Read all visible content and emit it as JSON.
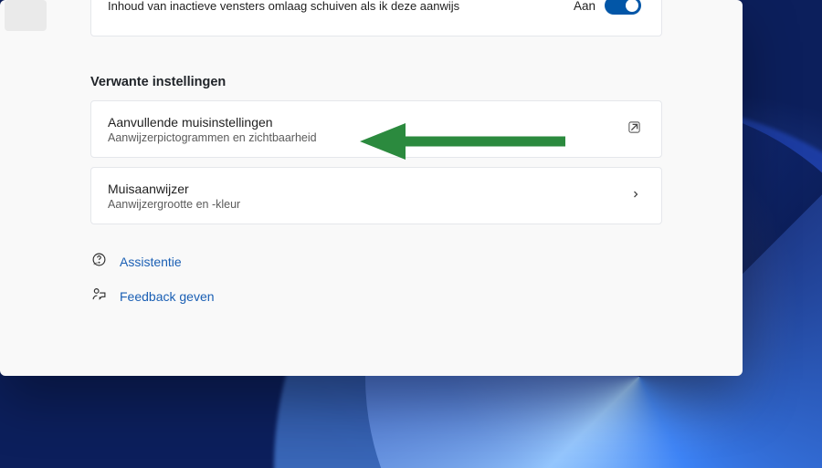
{
  "topcard": {
    "label": "Inhoud van inactieve vensters omlaag schuiven als ik deze aanwijs",
    "state": "Aan"
  },
  "section": {
    "heading": "Verwante instellingen",
    "items": [
      {
        "title": "Aanvullende muisinstellingen",
        "subtitle": "Aanwijzerpictogrammen en zichtbaarheid",
        "right": "external"
      },
      {
        "title": "Muisaanwijzer",
        "subtitle": "Aanwijzergrootte en -kleur",
        "right": "chevron"
      }
    ]
  },
  "links": [
    {
      "icon": "help",
      "label": "Assistentie"
    },
    {
      "icon": "feedback",
      "label": "Feedback geven"
    }
  ],
  "annotation": {
    "arrow_color": "#2b8a3e"
  }
}
